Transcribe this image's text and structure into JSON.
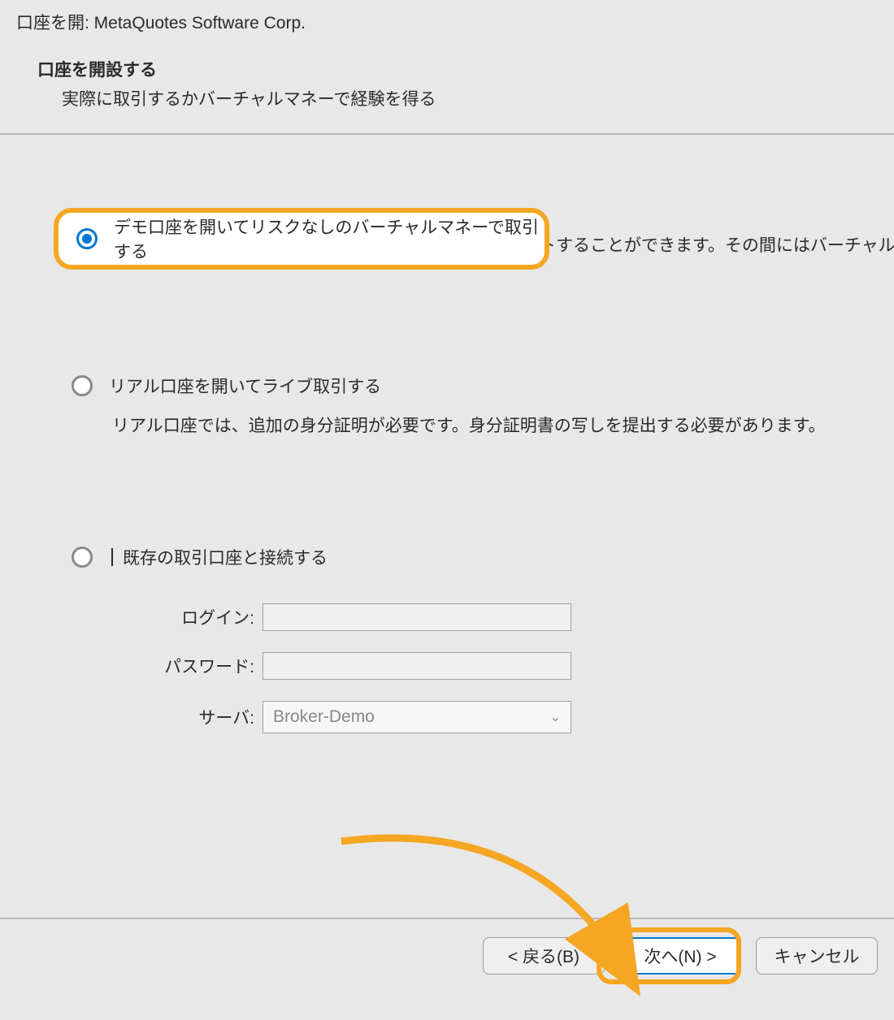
{
  "window": {
    "title": "口座を開: MetaQuotes Software Corp."
  },
  "header": {
    "title": "口座を開設する",
    "subtitle": "実際に取引するかバーチャルマネーで経験を得る"
  },
  "options": {
    "demo": {
      "label": "デモ口座を開いてリスクなしのバーチャルマネーで取引する",
      "description": "デモ口座では、証券取引所での取引を学び、戦略をテストすることができます。その間にはバーチャルマネ",
      "selected": true
    },
    "real": {
      "label": "リアル口座を開いてライブ取引する",
      "description": "リアル口座では、追加の身分証明が必要です。身分証明書の写しを提出する必要があります。",
      "selected": false
    },
    "existing": {
      "label": "既存の取引口座と接続する",
      "selected": false,
      "fields": {
        "login_label": "ログイン:",
        "login_value": "",
        "password_label": "パスワード:",
        "password_value": "",
        "server_label": "サーバ:",
        "server_value": "Broker-Demo"
      }
    }
  },
  "footer": {
    "back": "< 戻る(B)",
    "next": "次へ(N) >",
    "cancel": "キャンセル"
  },
  "annotation": {
    "highlight_color": "#f5a623"
  }
}
